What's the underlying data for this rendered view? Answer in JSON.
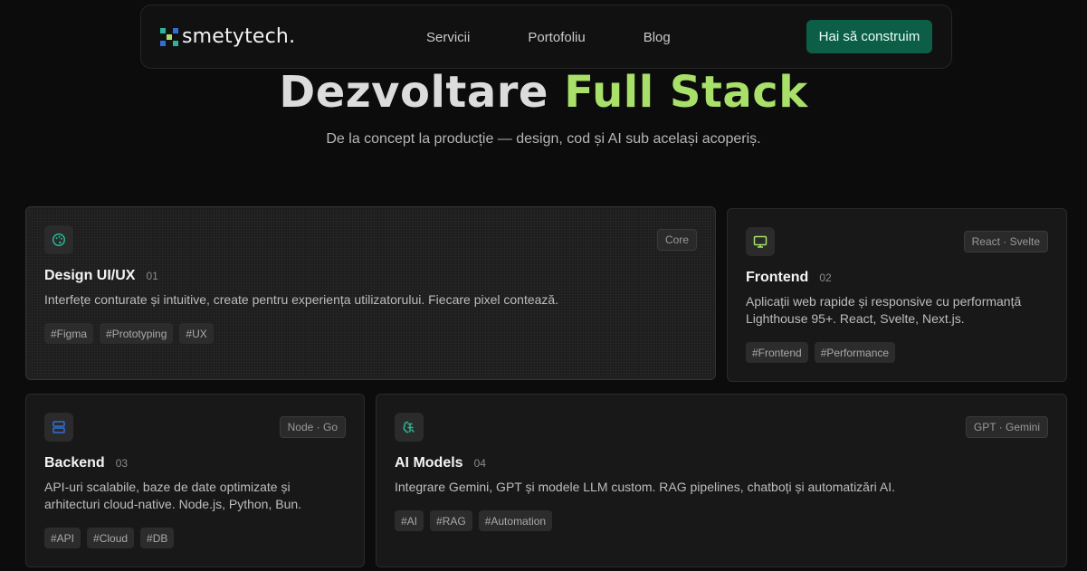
{
  "nav": {
    "logo_text": "smetytech.",
    "links": [
      "Servicii",
      "Portofoliu",
      "Blog"
    ],
    "cta_label": "Hai să construim"
  },
  "hero": {
    "title_part1": "Dezvoltare",
    "title_part2": "Full Stack",
    "subtitle": "De la concept la producție — design, cod și AI sub același acoperiș."
  },
  "colors": {
    "accent_green": "#a8e06a",
    "cta_bg": "#0c5e46",
    "icon_teal": "#2bb596",
    "icon_lime": "#a8e06a",
    "icon_blue": "#2f6fd6"
  },
  "services": [
    {
      "icon": "palette-icon",
      "badge": "Core",
      "title": "Design UI/UX",
      "number": "01",
      "description": "Interfețe conturate și intuitive, create pentru experiența utilizatorului. Fiecare pixel contează.",
      "tags": [
        "#Figma",
        "#Prototyping",
        "#UX"
      ]
    },
    {
      "icon": "monitor-icon",
      "badge": "React · Svelte",
      "title": "Frontend",
      "number": "02",
      "description": "Aplicații web rapide și responsive cu performanță Lighthouse 95+. React, Svelte, Next.js.",
      "tags": [
        "#Frontend",
        "#Performance"
      ]
    },
    {
      "icon": "server-icon",
      "badge": "Node · Go",
      "title": "Backend",
      "number": "03",
      "description": "API-uri scalabile, baze de date optimizate și arhitecturi cloud-native. Node.js, Python, Bun.",
      "tags": [
        "#API",
        "#Cloud",
        "#DB"
      ]
    },
    {
      "icon": "ai-brain-icon",
      "badge": "GPT · Gemini",
      "title": "AI Models",
      "number": "04",
      "description": "Integrare Gemini, GPT și modele LLM custom. RAG pipelines, chatboți și automatizări AI.",
      "tags": [
        "#AI",
        "#RAG",
        "#Automation"
      ]
    }
  ]
}
